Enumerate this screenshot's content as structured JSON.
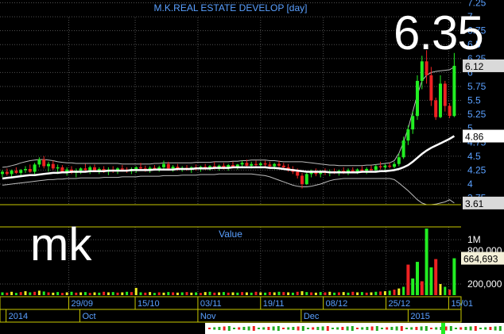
{
  "chart_data": [
    {
      "type": "candlestick",
      "title": "M.K.REAL ESTATE DEVELOP [day]",
      "symbol_watermark": "mk",
      "last_price_display": "6.35",
      "y_ticks": [
        "7.25",
        "7",
        "6.75",
        "6.5",
        "6.25",
        "6",
        "5.75",
        "5.5",
        "5.25",
        "5",
        "4.75",
        "4.5",
        "4.25",
        "4",
        "3.75"
      ],
      "ylim": [
        3.63,
        7.3
      ],
      "price_tags": [
        {
          "text": "6.12",
          "value": 6.12,
          "bg": "#d9d9d9",
          "fg": "#000000"
        },
        {
          "text": "4.86",
          "value": 4.86,
          "bg": "#ffffff",
          "fg": "#000000"
        },
        {
          "text": "3.61",
          "value": 3.66,
          "bg": "#d9d9d9",
          "fg": "#000000"
        }
      ],
      "candles": [
        [
          4.18,
          4.25,
          4.12,
          4.22
        ],
        [
          4.22,
          4.28,
          4.15,
          4.18
        ],
        [
          4.18,
          4.26,
          4.12,
          4.24
        ],
        [
          4.24,
          4.3,
          4.18,
          4.2
        ],
        [
          4.2,
          4.27,
          4.14,
          4.25
        ],
        [
          4.25,
          4.32,
          4.2,
          4.27
        ],
        [
          4.27,
          4.35,
          4.2,
          4.22
        ],
        [
          4.22,
          4.38,
          4.18,
          4.35
        ],
        [
          4.35,
          4.48,
          4.3,
          4.44
        ],
        [
          4.44,
          4.5,
          4.28,
          4.32
        ],
        [
          4.32,
          4.4,
          4.22,
          4.36
        ],
        [
          4.36,
          4.42,
          4.25,
          4.28
        ],
        [
          4.28,
          4.35,
          4.18,
          4.3
        ],
        [
          4.3,
          4.34,
          4.2,
          4.22
        ],
        [
          4.22,
          4.3,
          4.15,
          4.26
        ],
        [
          4.26,
          4.32,
          4.18,
          4.2
        ],
        [
          4.2,
          4.28,
          4.12,
          4.24
        ],
        [
          4.24,
          4.3,
          4.18,
          4.28
        ],
        [
          4.28,
          4.36,
          4.22,
          4.25
        ],
        [
          4.25,
          4.33,
          4.18,
          4.3
        ],
        [
          4.3,
          4.35,
          4.22,
          4.24
        ],
        [
          4.24,
          4.3,
          4.18,
          4.27
        ],
        [
          4.27,
          4.32,
          4.2,
          4.22
        ],
        [
          4.22,
          4.3,
          4.16,
          4.26
        ],
        [
          4.26,
          4.32,
          4.2,
          4.24
        ],
        [
          4.24,
          4.3,
          4.18,
          4.28
        ],
        [
          4.28,
          4.34,
          4.22,
          4.26
        ],
        [
          4.26,
          4.3,
          4.2,
          4.23
        ],
        [
          4.23,
          4.3,
          4.18,
          4.27
        ],
        [
          4.27,
          4.32,
          4.2,
          4.3
        ],
        [
          4.3,
          4.38,
          4.24,
          4.28
        ],
        [
          4.28,
          4.33,
          4.22,
          4.25
        ],
        [
          4.25,
          4.32,
          4.2,
          4.29
        ],
        [
          4.29,
          4.34,
          4.24,
          4.27
        ],
        [
          4.27,
          4.33,
          4.22,
          4.3
        ],
        [
          4.3,
          4.42,
          4.26,
          4.36
        ],
        [
          4.36,
          4.4,
          4.24,
          4.28
        ],
        [
          4.28,
          4.34,
          4.22,
          4.31
        ],
        [
          4.31,
          4.36,
          4.24,
          4.27
        ],
        [
          4.27,
          4.32,
          4.22,
          4.29
        ],
        [
          4.29,
          4.34,
          4.24,
          4.26
        ],
        [
          4.26,
          4.32,
          4.2,
          4.3
        ],
        [
          4.3,
          4.35,
          4.24,
          4.28
        ],
        [
          4.28,
          4.33,
          4.22,
          4.31
        ],
        [
          4.31,
          4.36,
          4.25,
          4.29
        ],
        [
          4.29,
          4.34,
          4.24,
          4.32
        ],
        [
          4.32,
          4.4,
          4.26,
          4.3
        ],
        [
          4.3,
          4.35,
          4.24,
          4.33
        ],
        [
          4.33,
          4.38,
          4.26,
          4.3
        ],
        [
          4.3,
          4.36,
          4.24,
          4.34
        ],
        [
          4.34,
          4.4,
          4.28,
          4.31
        ],
        [
          4.31,
          4.36,
          4.26,
          4.35
        ],
        [
          4.35,
          4.42,
          4.3,
          4.38
        ],
        [
          4.38,
          4.44,
          4.3,
          4.33
        ],
        [
          4.33,
          4.4,
          4.28,
          4.36
        ],
        [
          4.36,
          4.42,
          4.3,
          4.34
        ],
        [
          4.34,
          4.4,
          4.28,
          4.37
        ],
        [
          4.37,
          4.42,
          4.3,
          4.35
        ],
        [
          4.35,
          4.4,
          4.28,
          4.32
        ],
        [
          4.32,
          4.38,
          4.26,
          4.36
        ],
        [
          4.36,
          4.42,
          4.3,
          4.33
        ],
        [
          4.33,
          4.38,
          4.26,
          4.3
        ],
        [
          4.3,
          4.36,
          4.22,
          4.27
        ],
        [
          4.27,
          4.32,
          4.18,
          4.22
        ],
        [
          4.22,
          4.28,
          4.1,
          4.15
        ],
        [
          4.15,
          4.2,
          3.92,
          4.0
        ],
        [
          4.0,
          4.2,
          3.98,
          4.18
        ],
        [
          4.18,
          4.26,
          4.12,
          4.22
        ],
        [
          4.22,
          4.28,
          4.14,
          4.18
        ],
        [
          4.18,
          4.25,
          4.12,
          4.22
        ],
        [
          4.22,
          4.28,
          4.16,
          4.2
        ],
        [
          4.2,
          4.26,
          4.14,
          4.23
        ],
        [
          4.23,
          4.28,
          4.18,
          4.21
        ],
        [
          4.21,
          4.26,
          4.15,
          4.24
        ],
        [
          4.24,
          4.3,
          4.18,
          4.22
        ],
        [
          4.22,
          4.28,
          4.16,
          4.25
        ],
        [
          4.25,
          4.3,
          4.2,
          4.23
        ],
        [
          4.23,
          4.28,
          4.18,
          4.26
        ],
        [
          4.26,
          4.32,
          4.2,
          4.24
        ],
        [
          4.24,
          4.3,
          4.18,
          4.27
        ],
        [
          4.27,
          4.33,
          4.22,
          4.25
        ],
        [
          4.25,
          4.35,
          4.22,
          4.32
        ],
        [
          4.32,
          4.4,
          4.26,
          4.3
        ],
        [
          4.3,
          4.36,
          4.24,
          4.33
        ],
        [
          4.33,
          4.38,
          4.28,
          4.31
        ],
        [
          4.31,
          4.4,
          4.28,
          4.36
        ],
        [
          4.36,
          4.55,
          4.32,
          4.48
        ],
        [
          4.48,
          4.85,
          4.45,
          4.78
        ],
        [
          4.78,
          5.05,
          4.7,
          4.98
        ],
        [
          4.98,
          5.3,
          4.9,
          5.22
        ],
        [
          5.22,
          5.95,
          5.15,
          5.85
        ],
        [
          5.85,
          6.3,
          5.7,
          6.2
        ],
        [
          6.2,
          6.4,
          5.8,
          5.95
        ],
        [
          5.95,
          6.1,
          5.4,
          5.5
        ],
        [
          5.5,
          5.55,
          5.15,
          5.2
        ],
        [
          5.2,
          5.95,
          5.18,
          5.8
        ],
        [
          5.8,
          5.85,
          5.3,
          5.4
        ],
        [
          5.4,
          5.45,
          5.18,
          5.22
        ],
        [
          5.22,
          6.35,
          5.2,
          6.12
        ]
      ],
      "ma_values": [
        4.1,
        4.11,
        4.12,
        4.13,
        4.14,
        4.15,
        4.16,
        4.16,
        4.17,
        4.18,
        4.19,
        4.2,
        4.2,
        4.21,
        4.21,
        4.22,
        4.22,
        4.22,
        4.22,
        4.23,
        4.23,
        4.23,
        4.23,
        4.24,
        4.24,
        4.24,
        4.24,
        4.24,
        4.25,
        4.25,
        4.25,
        4.25,
        4.25,
        4.26,
        4.26,
        4.26,
        4.26,
        4.26,
        4.27,
        4.27,
        4.27,
        4.27,
        4.28,
        4.28,
        4.28,
        4.28,
        4.29,
        4.29,
        4.29,
        4.29,
        4.3,
        4.3,
        4.3,
        4.3,
        4.3,
        4.3,
        4.3,
        4.3,
        4.29,
        4.29,
        4.28,
        4.27,
        4.26,
        4.25,
        4.24,
        4.23,
        4.22,
        4.22,
        4.22,
        4.22,
        4.22,
        4.21,
        4.21,
        4.21,
        4.21,
        4.21,
        4.21,
        4.21,
        4.22,
        4.22,
        4.22,
        4.22,
        4.23,
        4.23,
        4.24,
        4.25,
        4.27,
        4.3,
        4.34,
        4.4,
        4.47,
        4.54,
        4.6,
        4.65,
        4.69,
        4.73,
        4.77,
        4.81,
        4.86
      ],
      "upper_band": [
        4.3,
        4.31,
        4.33,
        4.35,
        4.38,
        4.4,
        4.42,
        4.43,
        4.44,
        4.44,
        4.43,
        4.42,
        4.4,
        4.39,
        4.38,
        4.38,
        4.37,
        4.37,
        4.37,
        4.37,
        4.37,
        4.37,
        4.37,
        4.37,
        4.37,
        4.37,
        4.36,
        4.36,
        4.36,
        4.36,
        4.36,
        4.36,
        4.36,
        4.37,
        4.37,
        4.38,
        4.38,
        4.38,
        4.38,
        4.38,
        4.38,
        4.38,
        4.39,
        4.39,
        4.39,
        4.39,
        4.4,
        4.4,
        4.4,
        4.4,
        4.41,
        4.41,
        4.42,
        4.42,
        4.43,
        4.43,
        4.43,
        4.43,
        4.42,
        4.42,
        4.41,
        4.4,
        4.4,
        4.4,
        4.4,
        4.4,
        4.39,
        4.38,
        4.37,
        4.36,
        4.35,
        4.34,
        4.34,
        4.33,
        4.33,
        4.33,
        4.33,
        4.33,
        4.33,
        4.34,
        4.34,
        4.35,
        4.36,
        4.37,
        4.38,
        4.42,
        4.55,
        4.75,
        5.0,
        5.3,
        5.6,
        5.85,
        5.95,
        6.0,
        6.02,
        6.03,
        6.04,
        6.05,
        6.1
      ],
      "lower_band": [
        3.98,
        3.99,
        4.0,
        4.01,
        4.02,
        4.03,
        4.04,
        4.05,
        4.06,
        4.07,
        4.08,
        4.08,
        4.09,
        4.09,
        4.1,
        4.1,
        4.1,
        4.11,
        4.11,
        4.11,
        4.11,
        4.11,
        4.12,
        4.12,
        4.12,
        4.12,
        4.13,
        4.13,
        4.13,
        4.13,
        4.14,
        4.14,
        4.14,
        4.14,
        4.14,
        4.15,
        4.15,
        4.15,
        4.15,
        4.16,
        4.16,
        4.16,
        4.16,
        4.17,
        4.17,
        4.17,
        4.17,
        4.18,
        4.18,
        4.18,
        4.18,
        4.18,
        4.18,
        4.18,
        4.18,
        4.17,
        4.16,
        4.15,
        4.13,
        4.1,
        4.07,
        4.04,
        4.01,
        3.98,
        3.96,
        3.95,
        3.95,
        3.96,
        3.98,
        4.0,
        4.03,
        4.06,
        4.08,
        4.09,
        4.1,
        4.1,
        4.1,
        4.1,
        4.1,
        4.1,
        4.1,
        4.1,
        4.1,
        4.1,
        4.1,
        4.08,
        4.02,
        3.95,
        3.88,
        3.8,
        3.72,
        3.66,
        3.63,
        3.63,
        3.64,
        3.66,
        3.68,
        3.72,
        3.66
      ]
    },
    {
      "type": "bar",
      "title": "Value",
      "y_ticks": [
        "1M",
        "800,000",
        "200,000"
      ],
      "y_tick_values": [
        1000000,
        800000,
        200000
      ],
      "ylim": [
        0,
        1230000
      ],
      "last_value_tag": {
        "text": "664,693",
        "value": 664693
      },
      "values": [
        50000,
        45000,
        60000,
        40000,
        55000,
        70000,
        50000,
        60000,
        80000,
        65000,
        50000,
        45000,
        55000,
        40000,
        50000,
        60000,
        45000,
        50000,
        55000,
        40000,
        50000,
        45000,
        60000,
        50000,
        55000,
        45000,
        50000,
        60000,
        55000,
        130000,
        50000,
        45000,
        55000,
        40000,
        50000,
        45000,
        55000,
        50000,
        45000,
        50000,
        55000,
        45000,
        50000,
        40000,
        55000,
        60000,
        45000,
        50000,
        55000,
        45000,
        50000,
        45000,
        55000,
        50000,
        45000,
        60000,
        50000,
        45000,
        55000,
        50000,
        60000,
        55000,
        50000,
        45000,
        60000,
        70000,
        55000,
        50000,
        45000,
        55000,
        50000,
        60000,
        45000,
        50000,
        55000,
        45000,
        60000,
        50000,
        55000,
        45000,
        50000,
        60000,
        65000,
        70000,
        80000,
        100000,
        120000,
        150000,
        550000,
        300000,
        600000,
        250000,
        1200000,
        500000,
        650000,
        200000,
        150000,
        100000,
        664693
      ],
      "colors": [
        "#22ee22",
        "#ee2222",
        "#eeee22"
      ]
    }
  ],
  "time_axis": {
    "date_labels": [
      "29/09",
      "15/10",
      "03/11",
      "19/11",
      "08/12",
      "25/12",
      "15/01"
    ],
    "date_label_index": [
      18,
      36,
      53,
      70,
      87,
      104,
      121
    ],
    "month_labels": [
      "2014",
      "Oct",
      "Nov",
      "Dec",
      "2015"
    ],
    "month_label_index": [
      1,
      21,
      53,
      81,
      110
    ]
  },
  "theme": {
    "bg": "#000000",
    "grid": "#505050",
    "axis_text": "#5aa0ff",
    "title_color": "#5aa0ff",
    "up": "#22ee22",
    "down": "#ee2222",
    "panel_border": "#c8c800"
  }
}
